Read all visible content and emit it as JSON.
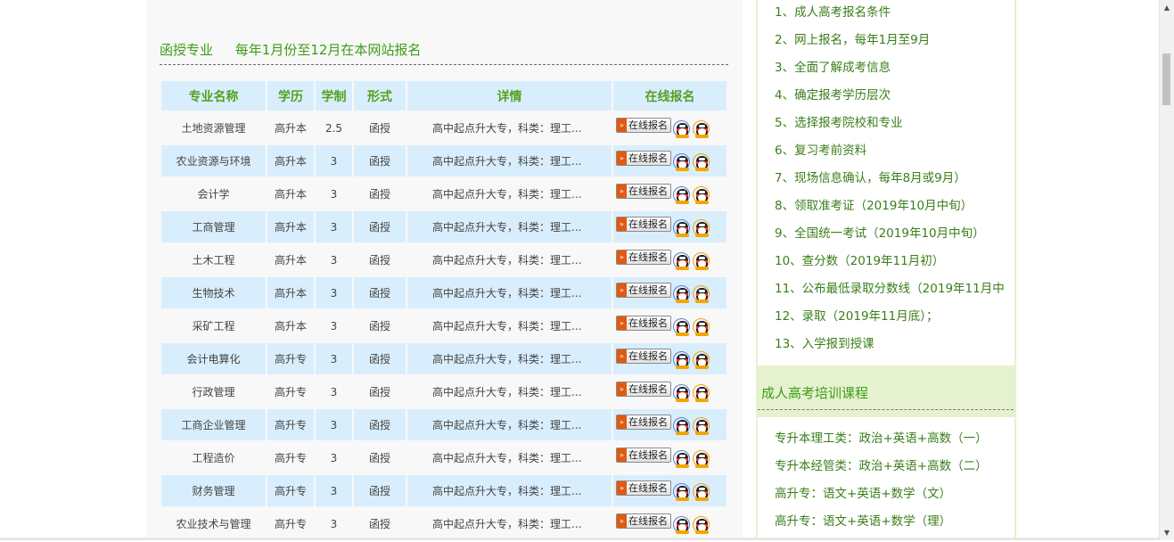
{
  "section": {
    "title": "函授专业",
    "subtitle": "每年1月份至12月在本网站报名"
  },
  "table": {
    "headers": [
      "专业名称",
      "学历",
      "学制",
      "形式",
      "详情",
      "在线报名"
    ],
    "apply_label": "在线报名",
    "apply_arrow": "»",
    "rows": [
      {
        "name": "土地资源管理",
        "level": "高升本",
        "years": "2.5",
        "form": "函授",
        "detail": "高中起点升大专，科类：理工..."
      },
      {
        "name": "农业资源与环境",
        "level": "高升本",
        "years": "3",
        "form": "函授",
        "detail": "高中起点升大专，科类：理工..."
      },
      {
        "name": "会计学",
        "level": "高升本",
        "years": "3",
        "form": "函授",
        "detail": "高中起点升大专，科类：理工..."
      },
      {
        "name": "工商管理",
        "level": "高升本",
        "years": "3",
        "form": "函授",
        "detail": "高中起点升大专，科类：理工..."
      },
      {
        "name": "土木工程",
        "level": "高升本",
        "years": "3",
        "form": "函授",
        "detail": "高中起点升大专，科类：理工..."
      },
      {
        "name": "生物技术",
        "level": "高升本",
        "years": "3",
        "form": "函授",
        "detail": "高中起点升大专，科类：理工..."
      },
      {
        "name": "采矿工程",
        "level": "高升本",
        "years": "3",
        "form": "函授",
        "detail": "高中起点升大专，科类：理工..."
      },
      {
        "name": "会计电算化",
        "level": "高升专",
        "years": "3",
        "form": "函授",
        "detail": "高中起点升大专，科类：理工..."
      },
      {
        "name": "行政管理",
        "level": "高升专",
        "years": "3",
        "form": "函授",
        "detail": "高中起点升大专，科类：理工..."
      },
      {
        "name": "工商企业管理",
        "level": "高升专",
        "years": "3",
        "form": "函授",
        "detail": "高中起点升大专，科类：理工..."
      },
      {
        "name": "工程造价",
        "level": "高升专",
        "years": "3",
        "form": "函授",
        "detail": "高中起点升大专，科类：理工..."
      },
      {
        "name": "财务管理",
        "level": "高升专",
        "years": "3",
        "form": "函授",
        "detail": "高中起点升大专，科类：理工..."
      },
      {
        "name": "农业技术与管理",
        "level": "高升专",
        "years": "3",
        "form": "函授",
        "detail": "高中起点升大专，科类：理工..."
      }
    ]
  },
  "sidebar": {
    "steps": [
      "1、成人高考报名条件",
      "2、网上报名，每年1月至9月",
      "3、全面了解成考信息",
      "4、确定报考学历层次",
      "5、选择报考院校和专业",
      "6、复习考前资料",
      "7、现场信息确认，每年8月或9月）",
      "8、领取准考证（2019年10月中旬）",
      "9、全国统一考试（2019年10月中旬）",
      "10、查分数（2019年11月初）",
      "11、公布最低录取分数线（2019年11月中",
      "12、录取（2019年11月底）；",
      "13、入学报到授课"
    ],
    "courses_title": "成人高考培训课程",
    "courses": [
      "专升本理工类：政治+英语+高数（一）",
      "专升本经管类：政治+英语+高数（二）",
      "高升专：语文+英语+数学（文）",
      "高升专：语文+英语+数学（理）"
    ]
  },
  "colors": {
    "accent_green": "#3e9c15",
    "header_blue": "#d9eefd",
    "sidebar_bg": "#e6f2cf"
  },
  "icons": {
    "qq": "qq-penguin-icon"
  }
}
